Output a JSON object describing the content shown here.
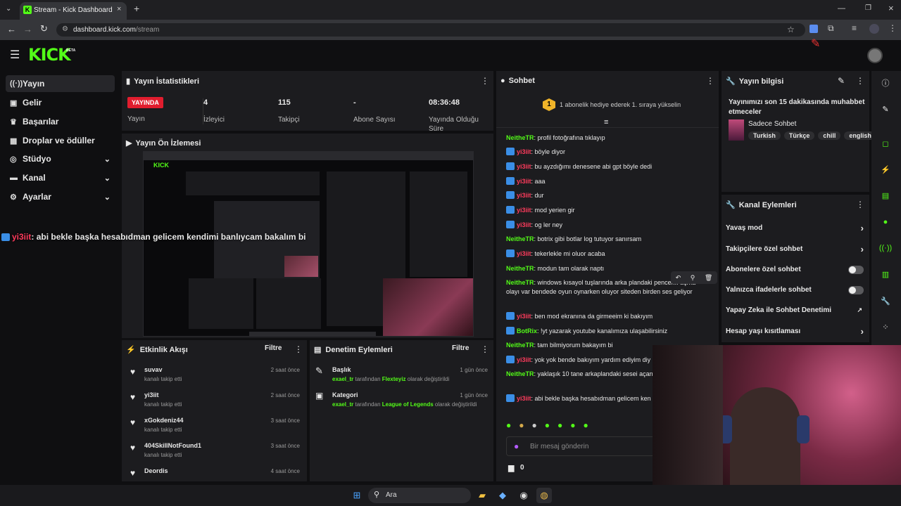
{
  "browser": {
    "tab_title": "Stream - Kick Dashboard",
    "url_host": "dashboard.kick.com",
    "url_path": "/stream"
  },
  "app": {
    "logo": "KICK",
    "logo_badge": "BETA"
  },
  "sidebar": {
    "items": [
      {
        "label": "Yayın",
        "icon": "stream-icon"
      },
      {
        "label": "Gelir",
        "icon": "revenue-icon"
      },
      {
        "label": "Başarılar",
        "icon": "trophy-icon"
      },
      {
        "label": "Droplar ve ödüller",
        "icon": "gift-icon"
      },
      {
        "label": "Stüdyo",
        "icon": "studio-icon"
      },
      {
        "label": "Kanal",
        "icon": "channel-icon"
      },
      {
        "label": "Ayarlar",
        "icon": "gear-icon"
      }
    ]
  },
  "overlay_chat": {
    "user": "yi3iit",
    "text": ": abi bekle başka hesabıdman gelicem kendimi banlıycam bakalım bi"
  },
  "stats": {
    "title": "Yayın İstatistikleri",
    "live_badge": "YAYINDA",
    "live_label": "Yayın",
    "viewers": "4",
    "viewers_label": "İzleyici",
    "followers": "115",
    "followers_label": "Takipçi",
    "subs": "-",
    "subs_label": "Abone Sayısı",
    "uptime": "08:36:48",
    "uptime_label": "Yayında Olduğu Süre"
  },
  "preview": {
    "title": "Yayın Ön İzlemesi"
  },
  "activity": {
    "title": "Etkinlik Akışı",
    "filter": "Filtre",
    "items": [
      {
        "user": "suvav",
        "action": "kanalı takip etti",
        "time": "2 saat önce"
      },
      {
        "user": "yi3iit",
        "action": "kanalı takip etti",
        "time": "2 saat önce"
      },
      {
        "user": "xGokdeniz44",
        "action": "kanalı takip etti",
        "time": "3 saat önce"
      },
      {
        "user": "404SkillNotFound1",
        "action": "kanalı takip etti",
        "time": "3 saat önce"
      },
      {
        "user": "Deordis",
        "action": "kanalı takip etti",
        "time": "4 saat önce"
      }
    ]
  },
  "moderation": {
    "title": "Denetim Eylemleri",
    "filter": "Filtre",
    "items": [
      {
        "title": "Başlık",
        "time": "1 gün önce",
        "by": "exael_tr",
        "mid": "tarafından",
        "value": "Flexteyiz",
        "end": "olarak değiştirildi"
      },
      {
        "title": "Kategori",
        "time": "1 gün önce",
        "by": "exael_tr",
        "mid": "tarafından",
        "value": "League of Legends",
        "end": "olarak değiştirildi"
      }
    ]
  },
  "chat": {
    "title": "Sohbet",
    "pinned_rank": "1",
    "pinned_text": "1 abonelik hediye ederek 1. sıraya yükselin",
    "placeholder": "Bir mesaj gönderin",
    "gift_count": "0",
    "messages": [
      {
        "user": "NeitheTR",
        "text": ": profil fotoğrafına tıklayıp",
        "color": "#53fc18",
        "badge": false
      },
      {
        "user": "yi3iit",
        "text": ": böyle diyor",
        "color": "#ff3b5c",
        "badge": true
      },
      {
        "user": "yi3iit",
        "text": ": bu ayzdığımı denesene abi gpt böyle dedi",
        "color": "#ff3b5c",
        "badge": true
      },
      {
        "user": "yi3iit",
        "text": ": aaa",
        "color": "#ff3b5c",
        "badge": true
      },
      {
        "user": "yi3iit",
        "text": ": dur",
        "color": "#ff3b5c",
        "badge": true
      },
      {
        "user": "yi3iit",
        "text": ": mod yerien gir",
        "color": "#ff3b5c",
        "badge": true
      },
      {
        "user": "yi3iit",
        "text": ": og ler ney",
        "color": "#ff3b5c",
        "badge": true
      },
      {
        "user": "NeitheTR",
        "text": ": botrix gibi botlar log tutuyor sanırsam",
        "color": "#53fc18",
        "badge": false
      },
      {
        "user": "yi3iit",
        "text": ": tekerlekle mi oluor acaba",
        "color": "#ff3b5c",
        "badge": true
      },
      {
        "user": "NeitheTR",
        "text": ": modun tam olarak naptı",
        "color": "#53fc18",
        "badge": false
      },
      {
        "user": "NeitheTR",
        "text": ": windows kısayol tuşlarında arka plandaki pencer... açma olayı var bendede oyun oynarken oluyor siteden birden ses geliyor",
        "color": "#53fc18",
        "badge": false
      },
      {
        "user": "yi3iit",
        "text": ": ben mod ekranına da girmeeim ki bakıyım",
        "color": "#ff3b5c",
        "badge": true
      },
      {
        "user": "BotRix",
        "text": ": !yt yazarak youtube kanalımıza ulaşabilirsiniz",
        "color": "#53fc18",
        "badge": true
      },
      {
        "user": "NeitheTR",
        "text": ": tam bilmiyorum bakayım bi",
        "color": "#53fc18",
        "badge": false
      },
      {
        "user": "yi3iit",
        "text": ": yok yok bende bakıyım yardım ediyim diy",
        "color": "#ff3b5c",
        "badge": true
      },
      {
        "user": "NeitheTR",
        "text": ": yaklaşık 10 tane arkaplandaki sesei açan varmış",
        "color": "#53fc18",
        "badge": false
      },
      {
        "user": "yi3iit",
        "text": ": abi bekle başka hesabıdman gelicem ken bakalım bi",
        "color": "#ff3b5c",
        "badge": true
      }
    ]
  },
  "stream_info": {
    "title": "Yayın bilgisi",
    "stream_title": "Yayınımızı son 15 dakikasında muhabbet etmeceler",
    "category": "Sadece Sohbet",
    "tags": [
      "Turkish",
      "Türkçe",
      "chill",
      "english"
    ]
  },
  "channel_actions": {
    "title": "Kanal Eylemleri",
    "items": [
      {
        "label": "Yavaş mod",
        "control": "chevron"
      },
      {
        "label": "Takipçilere özel sohbet",
        "control": "chevron"
      },
      {
        "label": "Abonelere özel sohbet",
        "control": "toggle"
      },
      {
        "label": "Yalnızca ifadelerle sohbet",
        "control": "toggle"
      },
      {
        "label": "Yapay Zeka ile Sohbet Denetimi",
        "control": "external"
      },
      {
        "label": "Hesap yaşı kısıtlaması",
        "control": "chevron"
      }
    ]
  },
  "taskbar": {
    "search": "Ara"
  }
}
